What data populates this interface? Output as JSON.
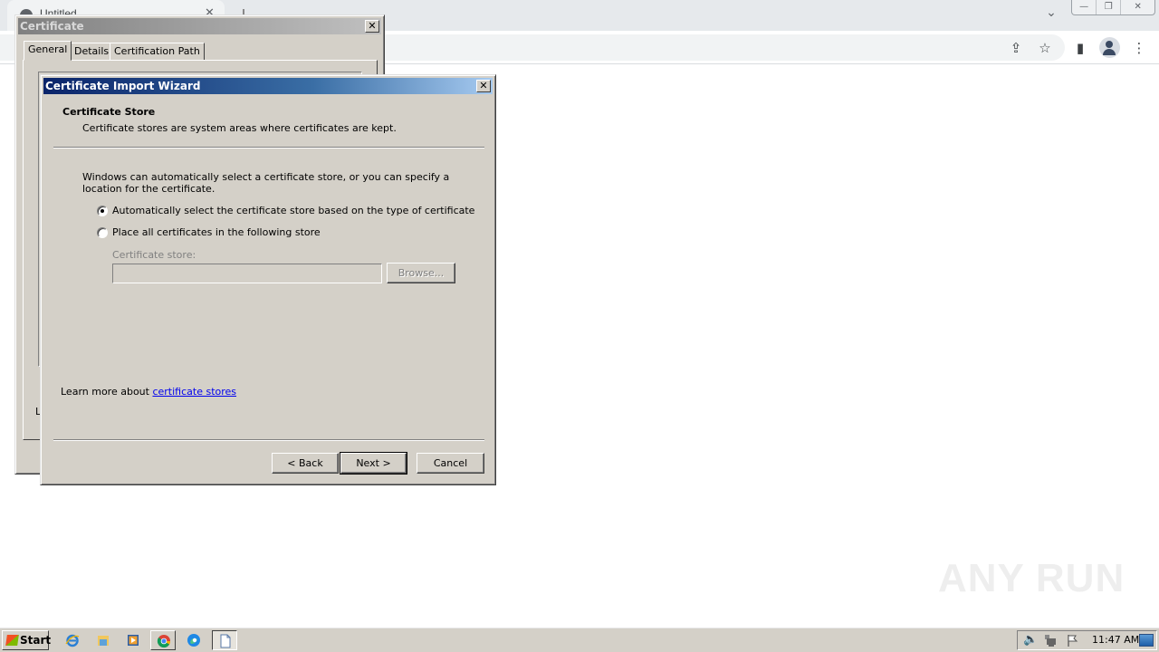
{
  "browser": {
    "tab_title": "Untitled",
    "tab_close_glyph": "✕",
    "tab_search_glyph": "⌄",
    "window_controls": {
      "minimize": "—",
      "restore": "❐",
      "close": "✕"
    },
    "toolbar_icons": {
      "share": "⇪",
      "bookmark": "☆",
      "side_panel": "▮",
      "menu": "⋮"
    }
  },
  "cert_dialog": {
    "title": "Certificate",
    "close_glyph": "✕",
    "tabs": [
      {
        "label": "General",
        "active": true
      },
      {
        "label": "Details",
        "active": false
      },
      {
        "label": "Certification Path",
        "active": false
      }
    ],
    "partial_text": "Le"
  },
  "wizard": {
    "title": "Certificate Import Wizard",
    "close_glyph": "✕",
    "heading": "Certificate Store",
    "subheading": "Certificate stores are system areas where certificates are kept.",
    "description": "Windows can automatically select a certificate store, or you can specify a location for the certificate.",
    "options": [
      {
        "label": "Automatically select the certificate store based on the type of certificate",
        "checked": true
      },
      {
        "label": "Place all certificates in the following store",
        "checked": false
      }
    ],
    "store_label": "Certificate store:",
    "store_value": "",
    "browse_label": "Browse...",
    "learn_prefix": "Learn more about ",
    "learn_link": "certificate stores",
    "buttons": {
      "back": "< Back",
      "next": "Next >",
      "cancel": "Cancel"
    }
  },
  "watermark": {
    "left": "ANY",
    "right": "RUN"
  },
  "taskbar": {
    "start_label": "Start",
    "apps": [
      "internet-explorer",
      "file-explorer",
      "media-player",
      "chrome",
      "edge",
      "notepad-document"
    ],
    "clock": "11:47 AM"
  }
}
